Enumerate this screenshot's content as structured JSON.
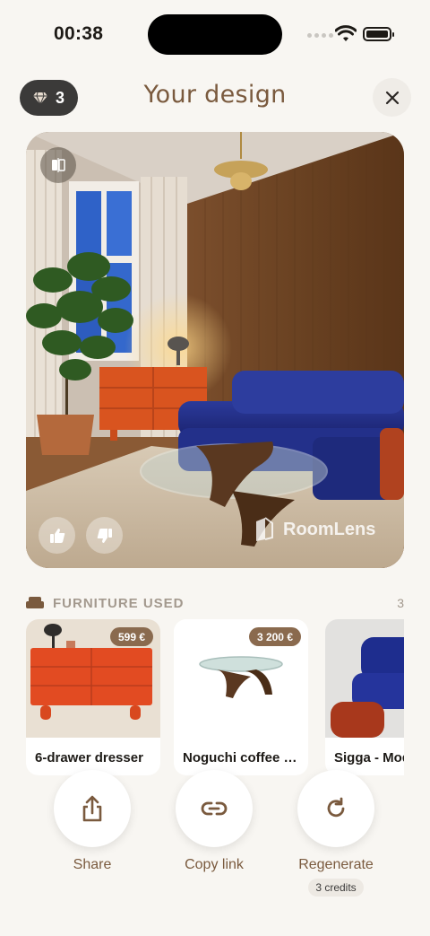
{
  "status_bar": {
    "time": "00:38"
  },
  "header": {
    "credits_count": "3",
    "title": "Your design"
  },
  "image": {
    "watermark": "RoomLens"
  },
  "furniture": {
    "section_title": "FURNITURE USED",
    "count": "3",
    "items": [
      {
        "name": "6-drawer dresser",
        "price": "599 €"
      },
      {
        "name": "Noguchi coffee table",
        "price": "3 200 €"
      },
      {
        "name": "Sigga - Modular sofa",
        "price": ""
      }
    ]
  },
  "actions": {
    "share_label": "Share",
    "copy_link_label": "Copy link",
    "regenerate_label": "Regenerate",
    "regenerate_cost": "3 credits"
  },
  "colors": {
    "accent": "#7a5a3e",
    "background": "#f8f6f2",
    "pill_dark": "#3b3a39",
    "price_badge": "#8a6a4e"
  }
}
